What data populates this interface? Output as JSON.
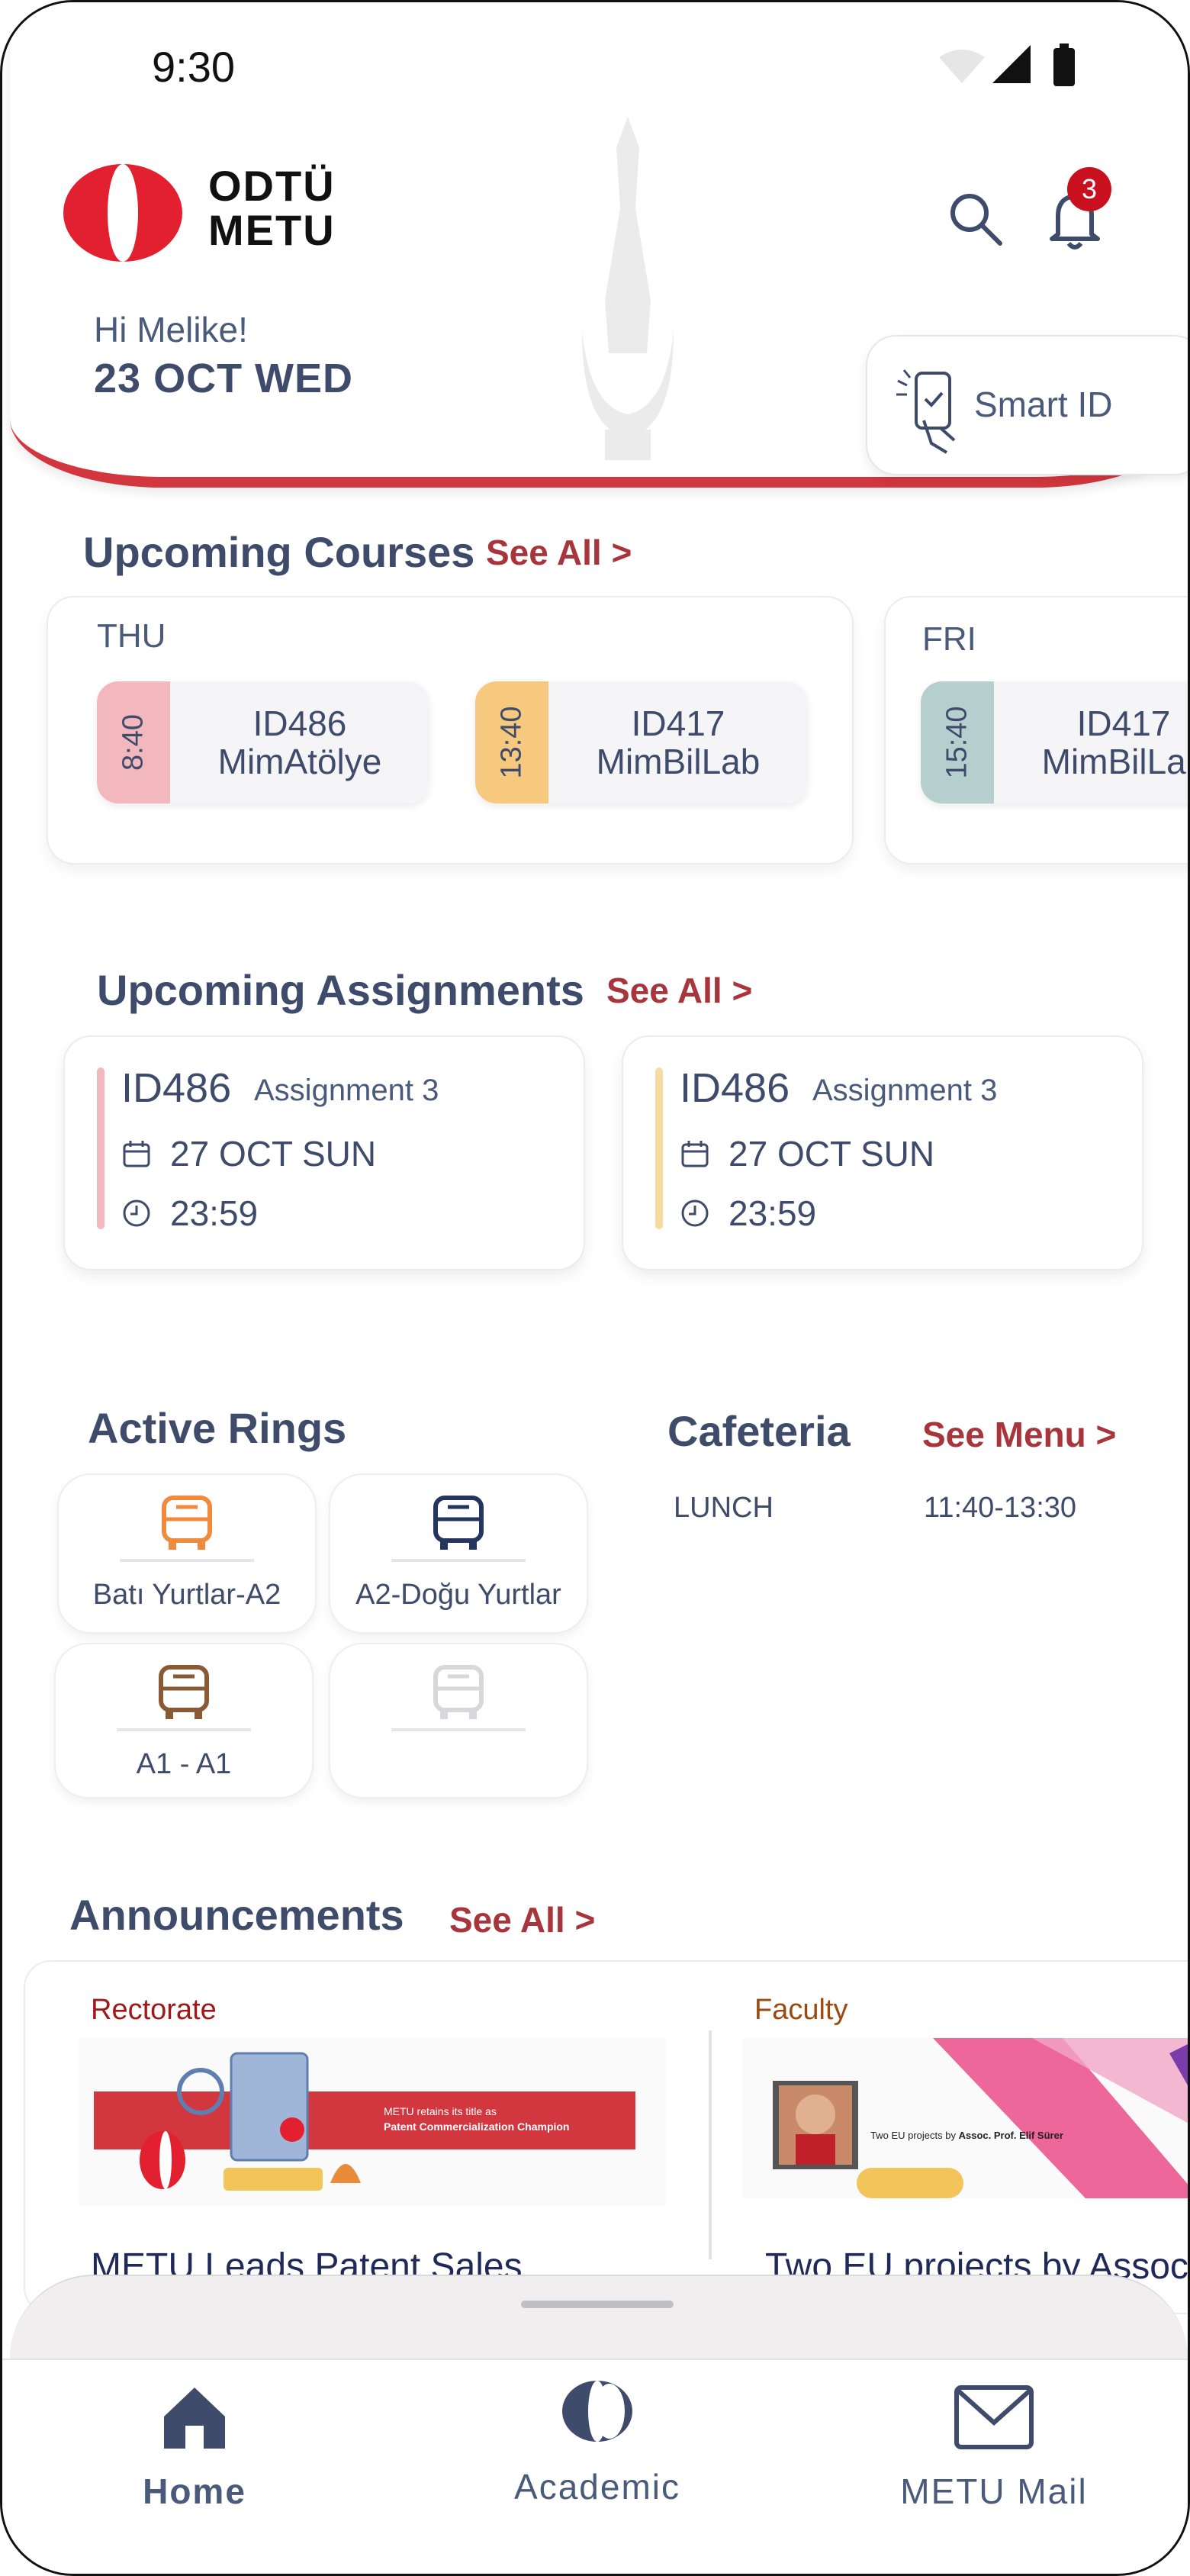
{
  "status_bar": {
    "time": "9:30"
  },
  "header": {
    "logo_line1": "ODTÜ",
    "logo_line2": "METU",
    "greeting": "Hi Melike!",
    "date": "23 OCT WED",
    "smart_id_label": "Smart ID",
    "notification_count": "3"
  },
  "courses": {
    "title": "Upcoming Courses",
    "see_all": "See All >",
    "days": [
      {
        "day": "THU",
        "items": [
          {
            "time": "8:40",
            "code": "ID486",
            "name": "MimAtölye",
            "color": "#f2b8bd"
          },
          {
            "time": "13:40",
            "code": "ID417",
            "name": "MimBilLab",
            "color": "#f6c97e"
          }
        ]
      },
      {
        "day": "FRI",
        "items": [
          {
            "time": "15:40",
            "code": "ID417",
            "name": "MimBilLab",
            "color": "#b5cfcf"
          }
        ]
      }
    ]
  },
  "assignments": {
    "title": "Upcoming Assignments",
    "see_all": "See All >",
    "items": [
      {
        "code": "ID486",
        "title": "Assignment 3",
        "date": "27 OCT SUN",
        "time": "23:59",
        "color": "#f2b8bd"
      },
      {
        "code": "ID486",
        "title": "Assignment 3",
        "date": "27 OCT SUN",
        "time": "23:59",
        "color": "#f6dca0"
      }
    ]
  },
  "rings": {
    "title": "Active Rings",
    "items": [
      {
        "label": "Batı Yurtlar-A2",
        "color": "#f08a3c"
      },
      {
        "label": "A2-Doğu Yurtlar",
        "color": "#24365e"
      },
      {
        "label": "A1 - A1",
        "color": "#8a5a36"
      },
      {
        "label": "",
        "color": "#d8d8dc"
      }
    ]
  },
  "cafeteria": {
    "title": "Cafeteria",
    "see_menu": "See Menu >",
    "meal": "LUNCH",
    "hours": "11:40-13:30"
  },
  "announcements": {
    "title": "Announcements",
    "see_all": "See All >",
    "items": [
      {
        "category": "Rectorate",
        "banner_text1": "METU retains its title as",
        "banner_text2": "Patent Commercialization Champion",
        "headline": "METU Leads Patent Sales"
      },
      {
        "category": "Faculty",
        "banner_text1": "Two EU projects by",
        "banner_text2": "Assoc. Prof. Elif Sürer",
        "headline": "Two EU projects by Assoc"
      }
    ]
  },
  "tabbar": {
    "home": "Home",
    "academic": "Academic",
    "mail": "METU Mail"
  },
  "colors": {
    "accent": "#d2363e",
    "link": "#a8353b",
    "text": "#3f4b6b"
  }
}
